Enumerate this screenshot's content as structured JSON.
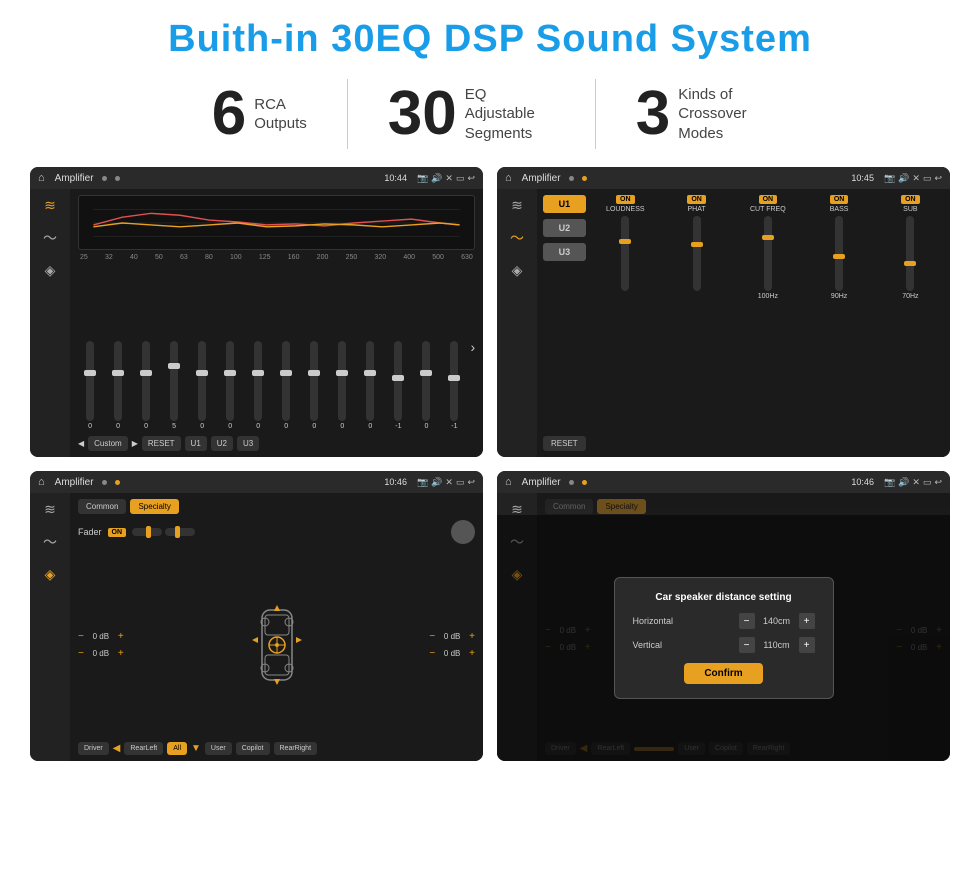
{
  "header": {
    "title": "Buith-in 30EQ DSP Sound System"
  },
  "stats": [
    {
      "number": "6",
      "text_line1": "RCA",
      "text_line2": "Outputs"
    },
    {
      "number": "30",
      "text_line1": "EQ Adjustable",
      "text_line2": "Segments"
    },
    {
      "number": "3",
      "text_line1": "Kinds of",
      "text_line2": "Crossover Modes"
    }
  ],
  "screens": [
    {
      "id": "eq-screen",
      "status_bar": {
        "title": "Amplifier",
        "time": "10:44"
      },
      "type": "eq",
      "freq_labels": [
        "25",
        "32",
        "40",
        "50",
        "63",
        "80",
        "100",
        "125",
        "160",
        "200",
        "250",
        "320",
        "400",
        "500",
        "630"
      ],
      "slider_values": [
        "0",
        "0",
        "0",
        "5",
        "0",
        "0",
        "0",
        "0",
        "0",
        "0",
        "0",
        "-1",
        "0",
        "-1"
      ],
      "bottom_btns": [
        "Custom",
        "RESET",
        "U1",
        "U2",
        "U3"
      ]
    },
    {
      "id": "crossover-screen",
      "status_bar": {
        "title": "Amplifier",
        "time": "10:45"
      },
      "type": "crossover",
      "u_buttons": [
        "U1",
        "U2",
        "U3"
      ],
      "channels": [
        {
          "label": "LOUDNESS",
          "on": true
        },
        {
          "label": "PHAT",
          "on": true
        },
        {
          "label": "CUT FREQ",
          "on": true
        },
        {
          "label": "BASS",
          "on": true
        },
        {
          "label": "SUB",
          "on": true
        }
      ],
      "reset_label": "RESET"
    },
    {
      "id": "fader-screen",
      "status_bar": {
        "title": "Amplifier",
        "time": "10:46"
      },
      "type": "fader",
      "tabs": [
        "Common",
        "Specialty"
      ],
      "active_tab": "Specialty",
      "fader_label": "Fader",
      "on_badge": "ON",
      "db_values": [
        "0 dB",
        "0 dB",
        "0 dB",
        "0 dB"
      ],
      "bottom_btns": [
        "Driver",
        "RearLeft",
        "All",
        "User",
        "Copilot",
        "RearRight"
      ]
    },
    {
      "id": "dialog-screen",
      "status_bar": {
        "title": "Amplifier",
        "time": "10:46"
      },
      "type": "fader-dialog",
      "tabs": [
        "Common",
        "Specialty"
      ],
      "dialog": {
        "title": "Car speaker distance setting",
        "horizontal_label": "Horizontal",
        "horizontal_value": "140cm",
        "vertical_label": "Vertical",
        "vertical_value": "110cm",
        "confirm_label": "Confirm"
      },
      "db_values": [
        "0 dB",
        "0 dB"
      ],
      "bottom_btns": [
        "Driver",
        "RearLeft",
        "All",
        "User",
        "Copilot",
        "RearRight"
      ]
    }
  ]
}
